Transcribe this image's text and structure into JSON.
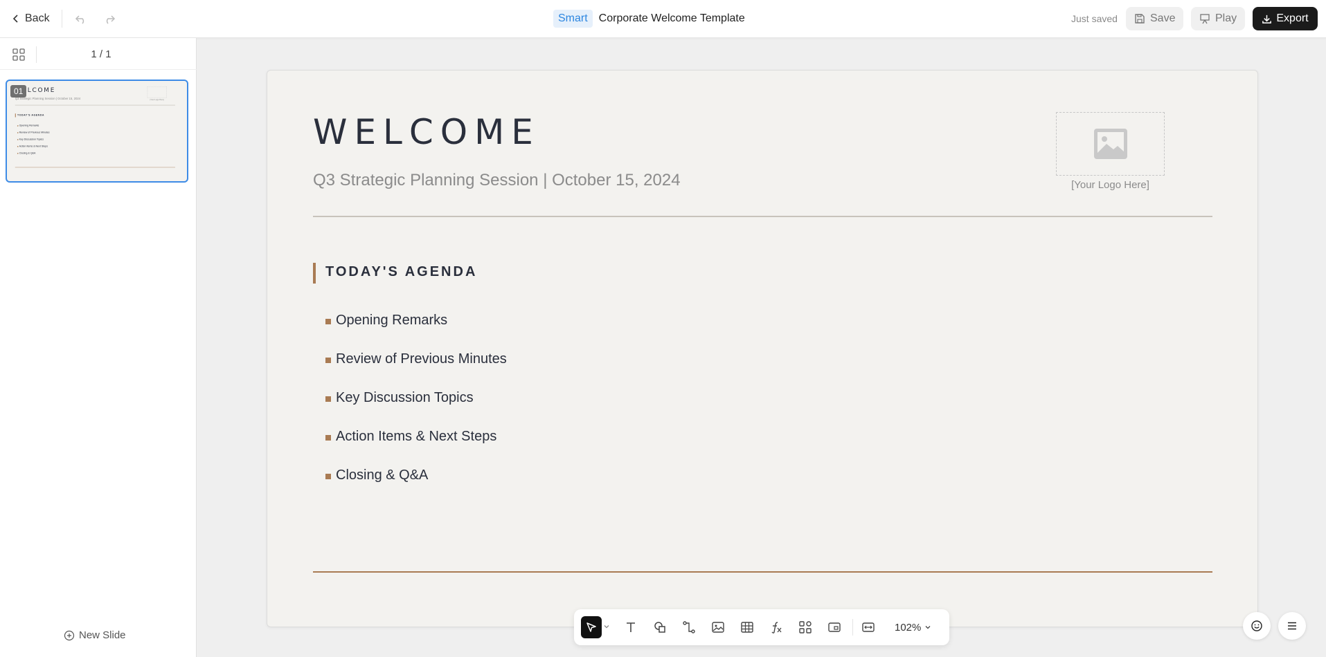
{
  "topbar": {
    "back_label": "Back",
    "smart_badge": "Smart",
    "title": "Corporate Welcome Template",
    "status": "Just saved",
    "save_label": "Save",
    "play_label": "Play",
    "export_label": "Export"
  },
  "sidebar": {
    "page_count": "1 / 1",
    "slides": [
      {
        "number": "01"
      }
    ],
    "new_slide_label": "New Slide"
  },
  "slide": {
    "heading": "WELCOME",
    "subtitle": "Q3 Strategic Planning Session | October 15, 2024",
    "logo_placeholder": "[Your Logo Here]",
    "agenda_title": "TODAY'S AGENDA",
    "agenda_items": [
      "Opening Remarks",
      "Review of Previous Minutes",
      "Key Discussion Topics",
      "Action Items & Next Steps",
      "Closing & Q&A"
    ]
  },
  "toolbar": {
    "zoom": "102%"
  },
  "colors": {
    "accent": "#a97b53",
    "primary_button": "#1b1b1b",
    "selection": "#3d8be6",
    "badge_text": "#2d86e0"
  }
}
